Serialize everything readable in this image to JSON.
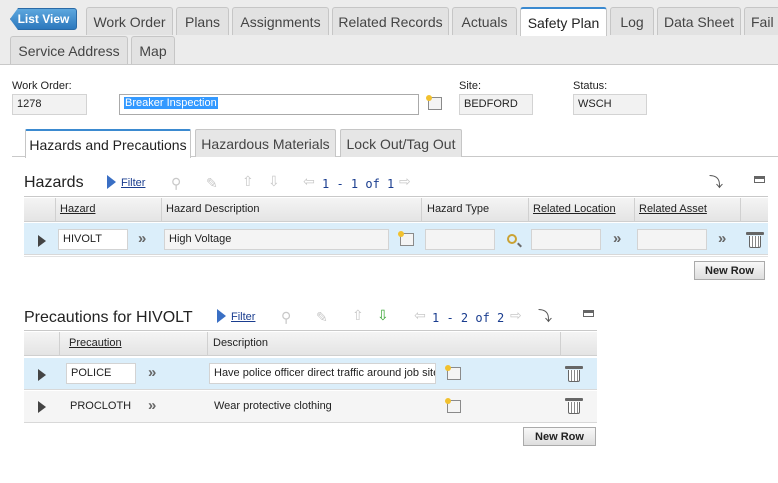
{
  "top_tabs": {
    "list_view": "List View",
    "row1": [
      "Work Order",
      "Plans",
      "Assignments",
      "Related Records",
      "Actuals",
      "Safety Plan",
      "Log",
      "Data Sheet",
      "Fail"
    ],
    "row2": [
      "Service Address",
      "Map"
    ],
    "active": "Safety Plan"
  },
  "header": {
    "work_order_label": "Work Order:",
    "work_order_value": "1278",
    "description_value": "Breaker Inspection",
    "site_label": "Site:",
    "site_value": "BEDFORD",
    "status_label": "Status:",
    "status_value": "WSCH"
  },
  "sub_tabs": [
    "Hazards and Precautions",
    "Hazardous Materials",
    "Lock Out/Tag Out"
  ],
  "hazards": {
    "title": "Hazards",
    "filter_label": "Filter",
    "count": "1 - 1 of 1",
    "columns": [
      "Hazard",
      "Hazard Description",
      "Hazard Type",
      "Related Location",
      "Related Asset"
    ],
    "rows": [
      {
        "hazard": "HIVOLT",
        "description": "High Voltage",
        "type": "",
        "location": "",
        "asset": ""
      }
    ],
    "new_row_label": "New Row"
  },
  "precautions": {
    "title": "Precautions for HIVOLT",
    "filter_label": "Filter",
    "count": "1 - 2 of 2",
    "columns": [
      "Precaution",
      "Description"
    ],
    "rows": [
      {
        "precaution": "POLICE",
        "description": "Have police officer direct traffic around job site"
      },
      {
        "precaution": "PROCLOTH",
        "description": "Wear protective clothing"
      }
    ],
    "new_row_label": "New Row"
  },
  "icons": {
    "filter": "filter-triangle-icon",
    "detail_menu": "detail-menu-icon",
    "lookup": "magnifier-icon",
    "delete": "trash-icon",
    "download": "download-icon",
    "accent": "#3b8ad0"
  }
}
